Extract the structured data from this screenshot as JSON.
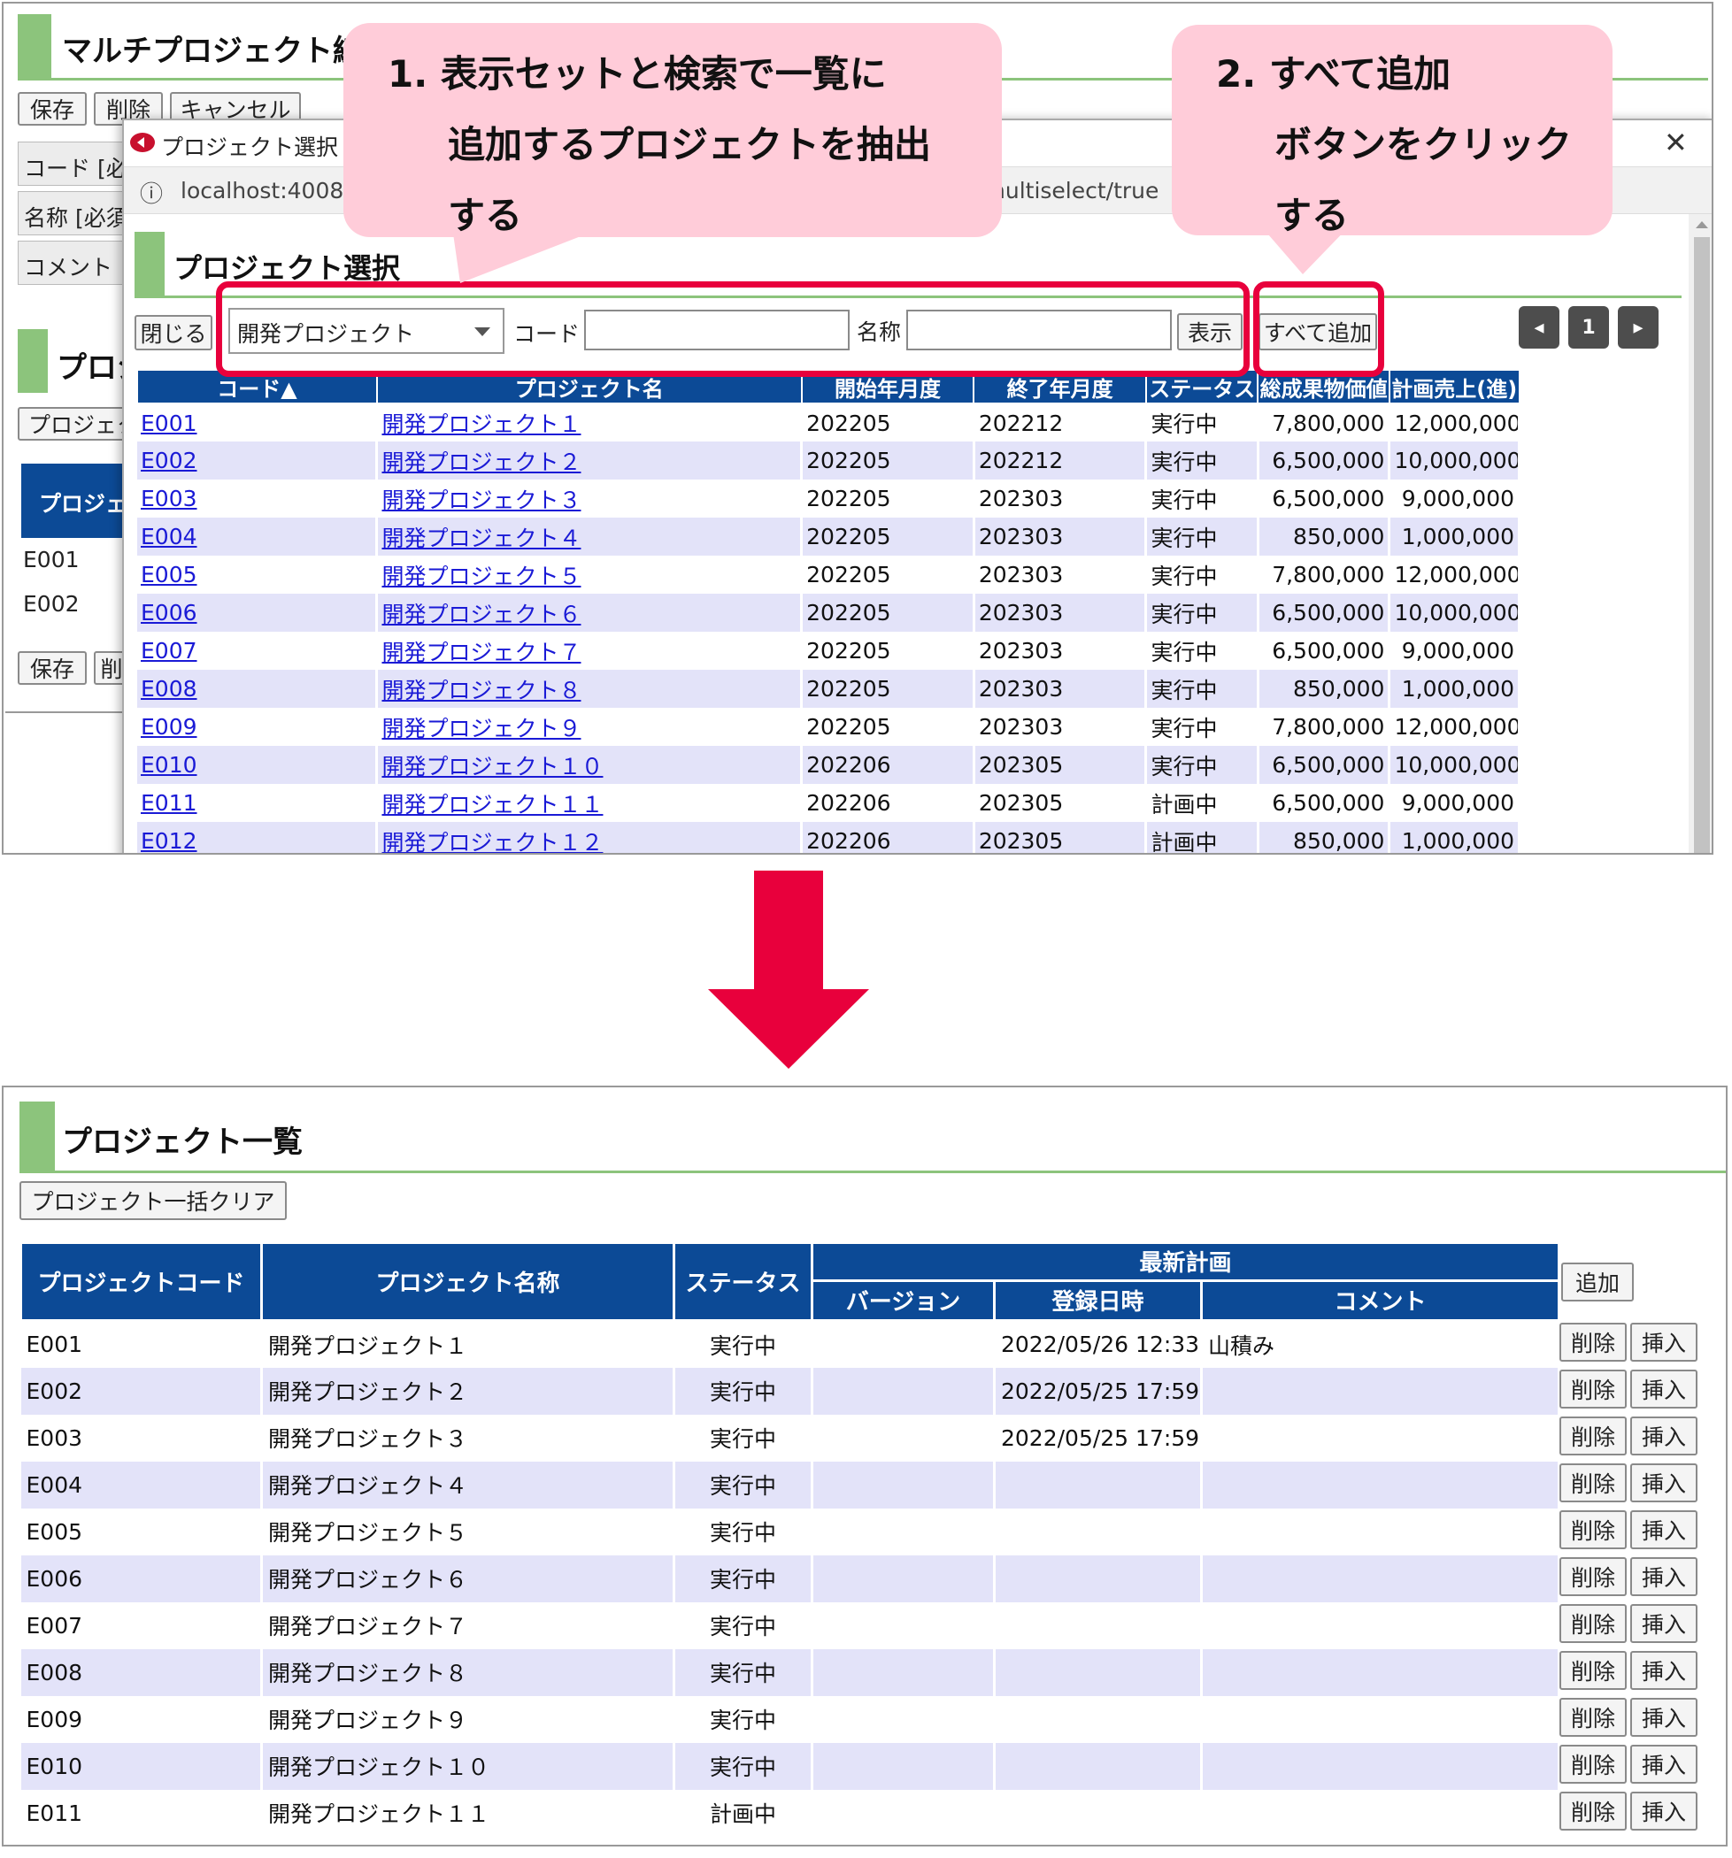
{
  "top": {
    "bg_title": "マルチプロジェクト編集",
    "bg_buttons": [
      "保存",
      "削除",
      "キャンセル"
    ],
    "bg_fields": [
      "コード [必",
      "名称 [必須",
      "コメント"
    ],
    "bg_section": "プロジ",
    "bg_section_btn": "プロジェク",
    "bg_table_head": "プロジェ",
    "bg_rows": [
      "E001",
      "E002"
    ],
    "bg_bottom_buttons": [
      "保存",
      "削"
    ],
    "browser": {
      "title": "プロジェクト選択 - Goo",
      "url": "localhost:40080",
      "url_tail": "nultiselect/true",
      "close_glyph": "✕",
      "info_glyph": "ⓘ"
    },
    "dialog": {
      "title": "プロジェクト選択",
      "close_button": "閉じる",
      "select_value": "開発プロジェクト",
      "code_label": "コード",
      "name_label": "名称",
      "show_button": "表示",
      "add_all_button": "すべて追加",
      "pager": [
        "◂",
        "1",
        "▸"
      ],
      "columns": [
        "コード▲",
        "プロジェクト名",
        "開始年月度",
        "終了年月度",
        "ステータス",
        "総成果物価値",
        "計画売上(進)"
      ],
      "rows": [
        [
          "E001",
          "開発プロジェクト１",
          "202205",
          "202212",
          "実行中",
          "7,800,000",
          "12,000,000"
        ],
        [
          "E002",
          "開発プロジェクト２",
          "202205",
          "202212",
          "実行中",
          "6,500,000",
          "10,000,000"
        ],
        [
          "E003",
          "開発プロジェクト３",
          "202205",
          "202303",
          "実行中",
          "6,500,000",
          "9,000,000"
        ],
        [
          "E004",
          "開発プロジェクト４",
          "202205",
          "202303",
          "実行中",
          "850,000",
          "1,000,000"
        ],
        [
          "E005",
          "開発プロジェクト５",
          "202205",
          "202303",
          "実行中",
          "7,800,000",
          "12,000,000"
        ],
        [
          "E006",
          "開発プロジェクト６",
          "202205",
          "202303",
          "実行中",
          "6,500,000",
          "10,000,000"
        ],
        [
          "E007",
          "開発プロジェクト７",
          "202205",
          "202303",
          "実行中",
          "6,500,000",
          "9,000,000"
        ],
        [
          "E008",
          "開発プロジェクト８",
          "202205",
          "202303",
          "実行中",
          "850,000",
          "1,000,000"
        ],
        [
          "E009",
          "開発プロジェクト９",
          "202205",
          "202303",
          "実行中",
          "7,800,000",
          "12,000,000"
        ],
        [
          "E010",
          "開発プロジェクト１０",
          "202206",
          "202305",
          "実行中",
          "6,500,000",
          "10,000,000"
        ],
        [
          "E011",
          "開発プロジェクト１１",
          "202206",
          "202305",
          "計画中",
          "6,500,000",
          "9,000,000"
        ],
        [
          "E012",
          "開発プロジェクト１２",
          "202206",
          "202305",
          "計画中",
          "850,000",
          "1,000,000"
        ]
      ]
    }
  },
  "callouts": {
    "step1": [
      "1. 表示セットと検索で一覧に",
      "追加するプロジェクトを抽出",
      "する"
    ],
    "step2": [
      "2. すべて追加",
      "ボタンをクリック",
      "する"
    ]
  },
  "bottom": {
    "title": "プロジェクト一覧",
    "clear_button": "プロジェクト一括クリア",
    "add_button": "追加",
    "headers": {
      "code": "プロジェクトコード",
      "name": "プロジェクト名称",
      "status": "ステータス",
      "latest_plan": "最新計画",
      "version": "バージョン",
      "registered": "登録日時",
      "comment": "コメント"
    },
    "row_buttons": [
      "削除",
      "挿入"
    ],
    "rows": [
      [
        "E001",
        "開発プロジェクト１",
        "実行中",
        "",
        "2022/05/26 12:33",
        "山積み"
      ],
      [
        "E002",
        "開発プロジェクト２",
        "実行中",
        "",
        "2022/05/25 17:59",
        ""
      ],
      [
        "E003",
        "開発プロジェクト３",
        "実行中",
        "",
        "2022/05/25 17:59",
        ""
      ],
      [
        "E004",
        "開発プロジェクト４",
        "実行中",
        "",
        "",
        ""
      ],
      [
        "E005",
        "開発プロジェクト５",
        "実行中",
        "",
        "",
        ""
      ],
      [
        "E006",
        "開発プロジェクト６",
        "実行中",
        "",
        "",
        ""
      ],
      [
        "E007",
        "開発プロジェクト７",
        "実行中",
        "",
        "",
        ""
      ],
      [
        "E008",
        "開発プロジェクト８",
        "実行中",
        "",
        "",
        ""
      ],
      [
        "E009",
        "開発プロジェクト９",
        "実行中",
        "",
        "",
        ""
      ],
      [
        "E010",
        "開発プロジェクト１０",
        "実行中",
        "",
        "",
        ""
      ],
      [
        "E011",
        "開発プロジェクト１１",
        "計画中",
        "",
        "",
        ""
      ]
    ]
  },
  "colors": {
    "header_blue": "#0c4a96",
    "accent_green": "#8cc47c",
    "callout_pink": "#ffccd9",
    "highlight_red": "#e8003c",
    "row_alt": "#e3e3f9",
    "link": "#1a1ad6"
  }
}
